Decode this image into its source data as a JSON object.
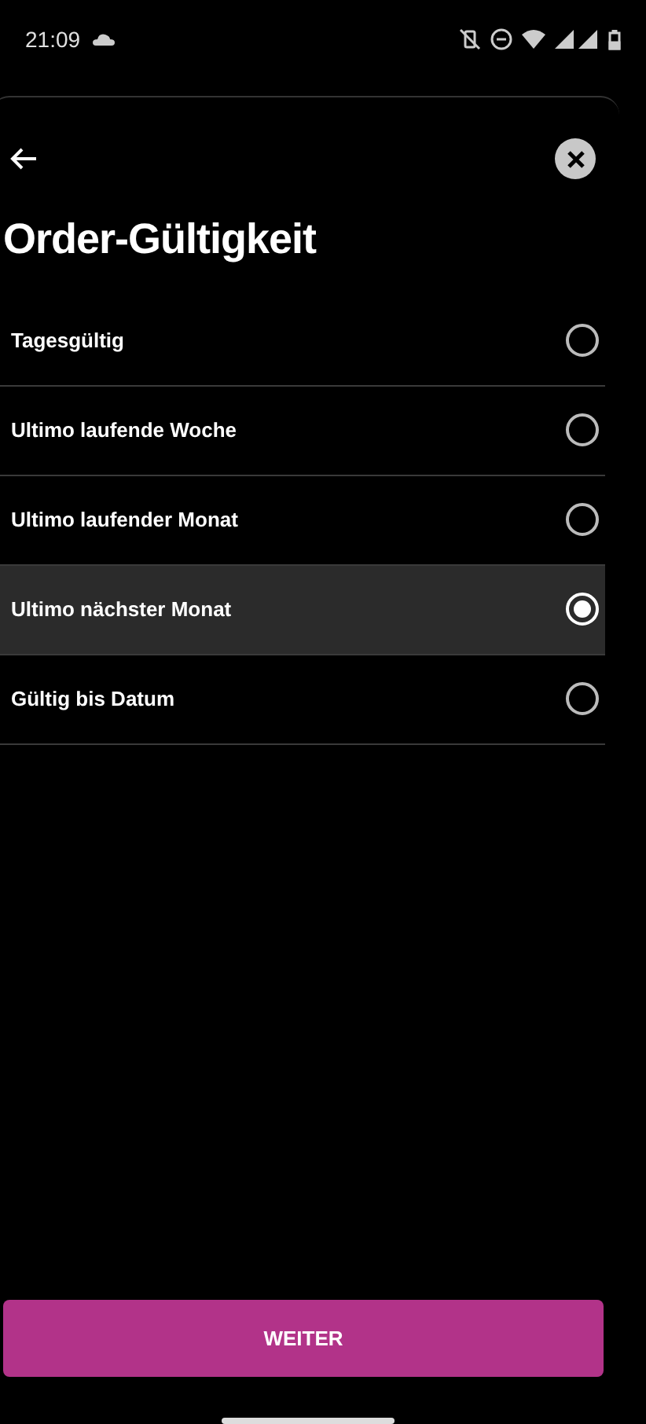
{
  "status_bar": {
    "time": "21:09"
  },
  "title": "Order-Gültigkeit",
  "options": [
    {
      "label": "Tagesgültig",
      "selected": false
    },
    {
      "label": "Ultimo laufende Woche",
      "selected": false
    },
    {
      "label": "Ultimo laufender Monat",
      "selected": false
    },
    {
      "label": "Ultimo nächster Monat",
      "selected": true
    },
    {
      "label": "Gültig bis Datum",
      "selected": false
    }
  ],
  "button": "WEITER"
}
